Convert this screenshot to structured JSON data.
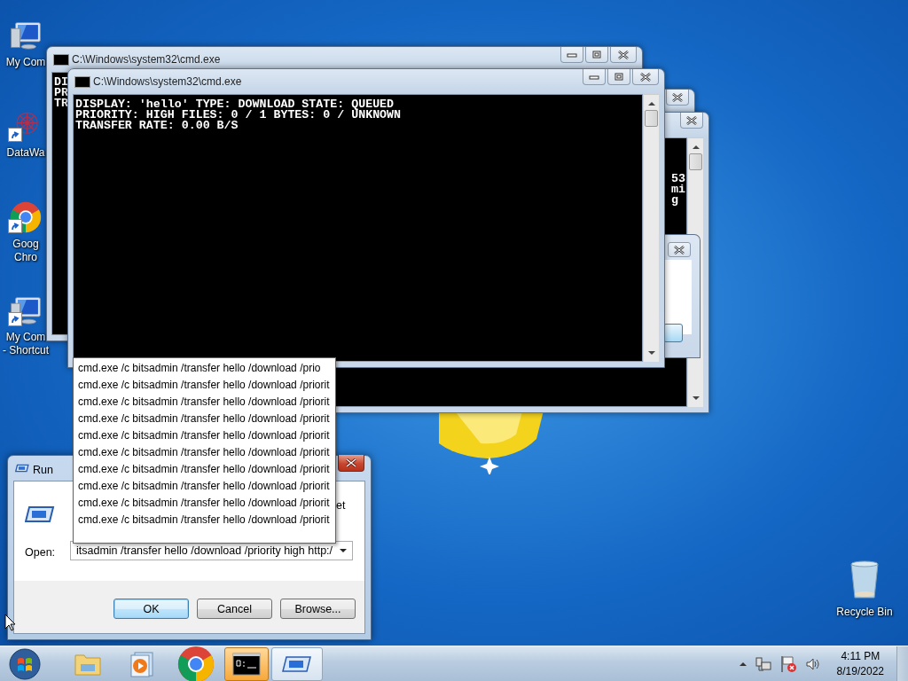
{
  "desktop_icons": [
    {
      "kind": "computer",
      "lines": [
        "My Com"
      ],
      "shortcut": false
    },
    {
      "kind": "artwork",
      "lines": [
        "DataWa"
      ],
      "shortcut": true
    },
    {
      "kind": "chrome",
      "lines": [
        "Goog",
        "Chro"
      ],
      "shortcut": true
    },
    {
      "kind": "computer",
      "lines": [
        "My Com",
        "- Shortcut"
      ],
      "shortcut": true
    },
    {
      "kind": "recycle",
      "lines": [
        "Recycle Bin"
      ],
      "shortcut": false
    }
  ],
  "consoles": [
    {
      "title": "C:\\Windows\\system32\\cmd.exe",
      "lines": [
        "DI",
        "PR",
        "TR"
      ]
    },
    {
      "title": "C:\\Windows\\system32\\cmd.exe",
      "lines": [
        "DISPLAY: 'hello' TYPE: DOWNLOAD STATE: QUEUED",
        "PRIORITY: HIGH FILES: 0 / 1 BYTES: 0 / UNKNOWN",
        "TRANSFER RATE: 0.00 B/S"
      ]
    }
  ],
  "background_console": {
    "lines": [
      "53",
      "mi",
      "g"
    ]
  },
  "autocomplete": {
    "items": [
      "cmd.exe /c bitsadmin /transfer hello /download /prio",
      "cmd.exe /c bitsadmin /transfer hello /download /priorit",
      "cmd.exe /c bitsadmin /transfer hello /download /priorit",
      "cmd.exe /c bitsadmin /transfer hello /download /priorit",
      "cmd.exe /c bitsadmin /transfer hello /download /priorit",
      "cmd.exe /c bitsadmin /transfer hello /download /priorit",
      "cmd.exe /c bitsadmin /transfer hello /download /priorit",
      "cmd.exe /c bitsadmin /transfer hello /download /priorit",
      "cmd.exe /c bitsadmin /transfer hello /download /priorit",
      "cmd.exe /c bitsadmin /transfer hello /download /priorit"
    ]
  },
  "run_dialog": {
    "title": "Run",
    "description_fragment": "et",
    "open_label": "Open:",
    "value": "itsadmin /transfer hello /download /priority high http:/",
    "buttons": [
      {
        "label": "OK",
        "default": true
      },
      {
        "label": "Cancel",
        "default": false
      },
      {
        "label": "Browse...",
        "default": false
      }
    ]
  },
  "taskbar": {
    "items": [
      {
        "kind": "start",
        "selected": false,
        "flashing": false
      },
      {
        "kind": "explorer",
        "selected": false,
        "flashing": false
      },
      {
        "kind": "media",
        "selected": false,
        "flashing": false
      },
      {
        "kind": "chrome",
        "selected": false,
        "flashing": false
      },
      {
        "kind": "console",
        "selected": false,
        "flashing": true
      },
      {
        "kind": "run",
        "selected": true,
        "flashing": false
      }
    ],
    "tray": {
      "time": "4:11 PM",
      "date": "8/19/2022"
    }
  }
}
